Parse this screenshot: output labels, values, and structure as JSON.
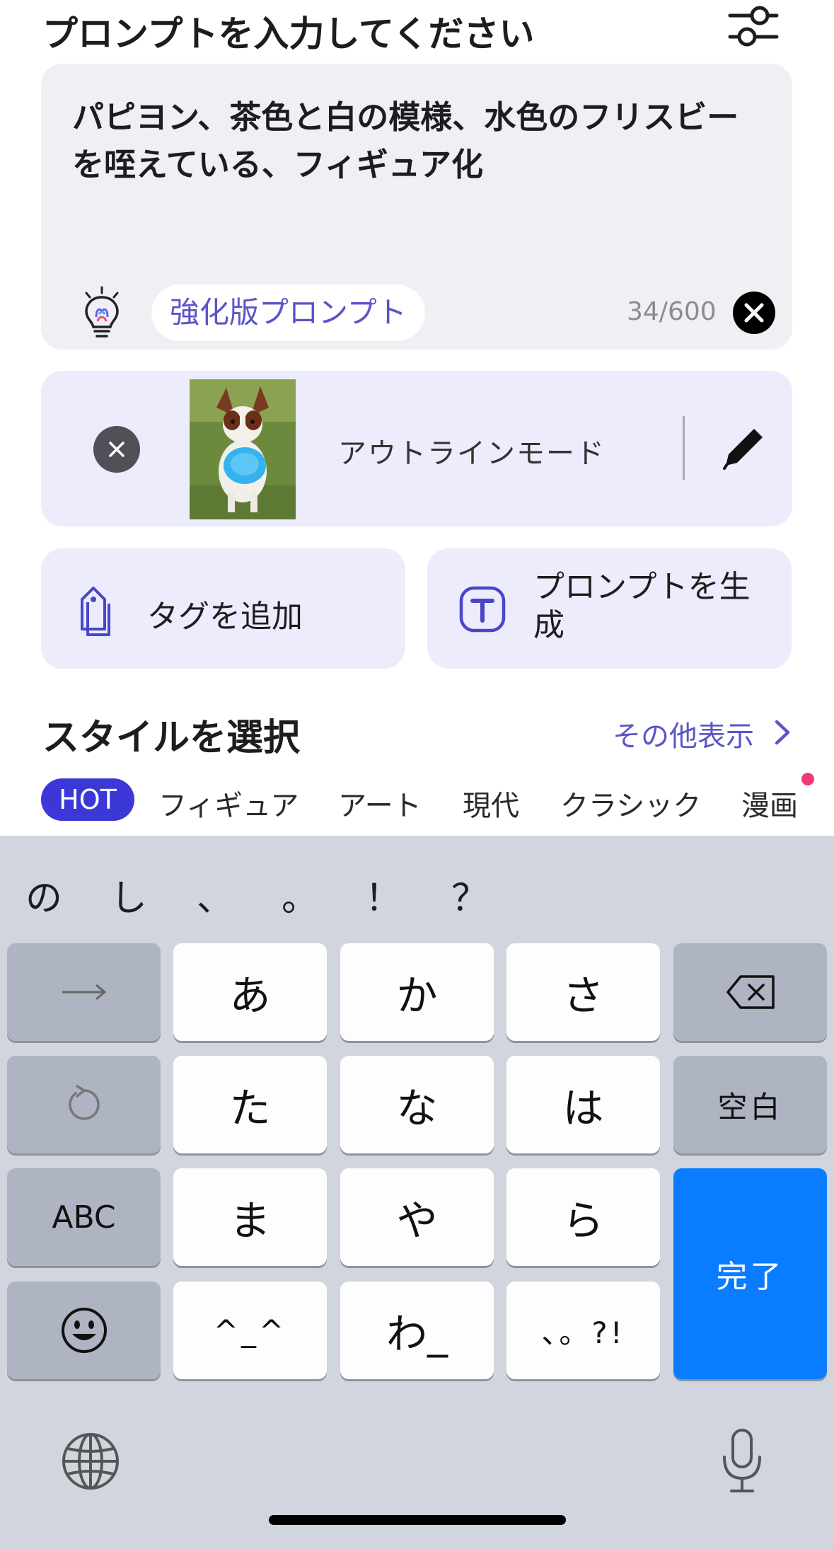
{
  "header": {
    "title": "プロンプトを入力してください",
    "settings_icon": "sliders-icon"
  },
  "prompt": {
    "text": "パピヨン、茶色と白の模様、水色のフリスビーを咥えている、フィギュア化",
    "enhance_label": "強化版プロンプト",
    "counter": "34/600"
  },
  "reference": {
    "mode_label": "アウトラインモード",
    "image_alt": "パピヨン"
  },
  "actions": {
    "add_tag": "タグを追加",
    "generate_prompt": "プロンプトを生成"
  },
  "style": {
    "title": "スタイルを選択",
    "more": "その他表示",
    "tabs": [
      "HOT",
      "フィギュア",
      "アート",
      "現代",
      "クラシック",
      "漫画"
    ]
  },
  "keyboard": {
    "candidates": [
      "の",
      "し",
      "、",
      "。",
      "！",
      "？"
    ],
    "keys": {
      "a": "あ",
      "ka": "か",
      "sa": "さ",
      "ta": "た",
      "na": "な",
      "ha": "は",
      "space": "空白",
      "abc": "ABC",
      "ma": "ま",
      "ya": "や",
      "ra": "ら",
      "done": "完了",
      "kaomoji": "^_^",
      "wa": "わ_",
      "punct": "、。?!"
    }
  },
  "colors": {
    "accent": "#5a55c8",
    "hot_tab": "#3c38d8",
    "done_key": "#0a7cff",
    "card": "#eff0f4",
    "card_tint": "#ececfc"
  }
}
